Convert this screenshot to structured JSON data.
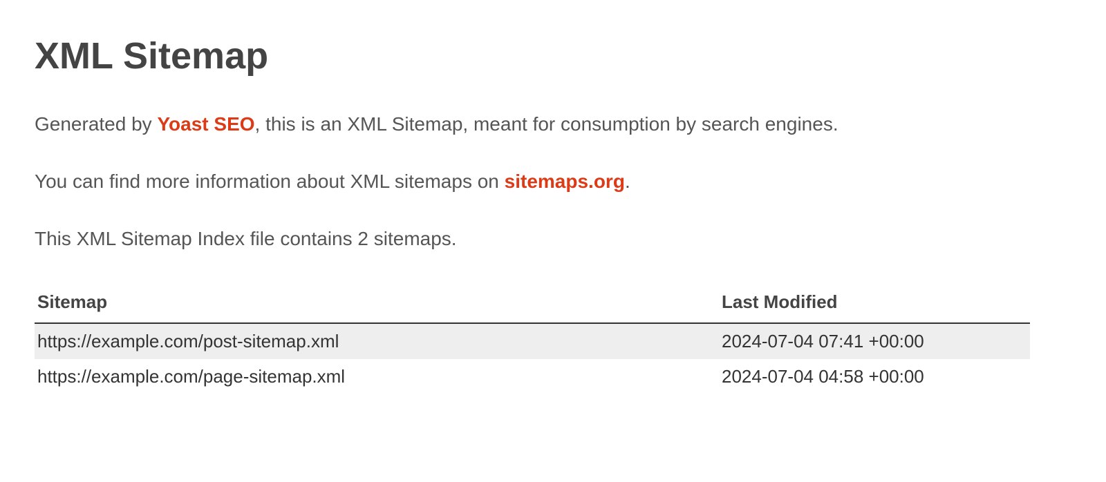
{
  "title": "XML Sitemap",
  "intro": {
    "prefix": "Generated by ",
    "generator_link": "Yoast SEO",
    "suffix": ", this is an XML Sitemap, meant for consumption by search engines."
  },
  "more_info": {
    "prefix": "You can find more information about XML sitemaps on ",
    "link_text": "sitemaps.org",
    "suffix": "."
  },
  "count_line": "This XML Sitemap Index file contains 2 sitemaps.",
  "table": {
    "headers": {
      "sitemap": "Sitemap",
      "last_modified": "Last Modified"
    },
    "rows": [
      {
        "url": "https://example.com/post-sitemap.xml",
        "last_modified": "2024-07-04 07:41 +00:00"
      },
      {
        "url": "https://example.com/page-sitemap.xml",
        "last_modified": "2024-07-04 04:58 +00:00"
      }
    ]
  }
}
